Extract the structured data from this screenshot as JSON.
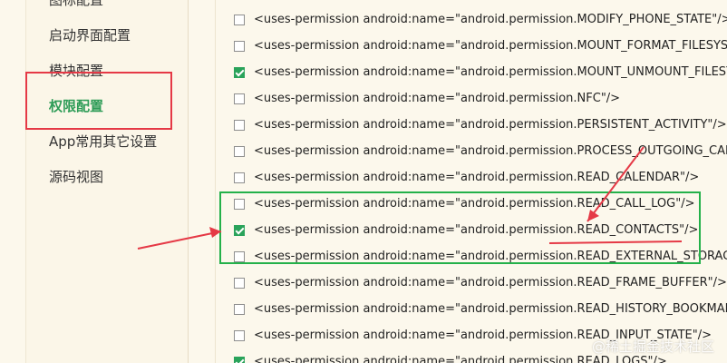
{
  "sidebar": {
    "items": [
      {
        "label": "图标配置"
      },
      {
        "label": "启动界面配置"
      },
      {
        "label": "模块配置"
      },
      {
        "label": "权限配置",
        "active": true
      },
      {
        "label": "App常用其它设置"
      },
      {
        "label": "源码视图"
      }
    ]
  },
  "permissions": [
    {
      "text": "<uses-permission android:name=\"android.permission.MODIFY_PHONE_STATE\"/>",
      "checked": false
    },
    {
      "text": "<uses-permission android:name=\"android.permission.MOUNT_FORMAT_FILESYSTEMS\"/>",
      "checked": false
    },
    {
      "text": "<uses-permission android:name=\"android.permission.MOUNT_UNMOUNT_FILESYSTEMS\"/>",
      "checked": true
    },
    {
      "text": "<uses-permission android:name=\"android.permission.NFC\"/>",
      "checked": false
    },
    {
      "text": "<uses-permission android:name=\"android.permission.PERSISTENT_ACTIVITY\"/>",
      "checked": false
    },
    {
      "text": "<uses-permission android:name=\"android.permission.PROCESS_OUTGOING_CALLS\"/>",
      "checked": false
    },
    {
      "text": "<uses-permission android:name=\"android.permission.READ_CALENDAR\"/>",
      "checked": false
    },
    {
      "text": "<uses-permission android:name=\"android.permission.READ_CALL_LOG\"/>",
      "checked": false
    },
    {
      "text": "<uses-permission android:name=\"android.permission.READ_CONTACTS\"/>",
      "checked": true
    },
    {
      "text": "<uses-permission android:name=\"android.permission.READ_EXTERNAL_STORAGE\"/>",
      "checked": false
    },
    {
      "text": "<uses-permission android:name=\"android.permission.READ_FRAME_BUFFER\"/>",
      "checked": false
    },
    {
      "text": "<uses-permission android:name=\"android.permission.READ_HISTORY_BOOKMARKS\"/>",
      "checked": false
    },
    {
      "text": "<uses-permission android:name=\"android.permission.READ_INPUT_STATE\"/>",
      "checked": false
    },
    {
      "text": "<uses-permission android:name=\"android.permission.READ_LOGS\"/>",
      "checked": true
    }
  ],
  "watermark": "@稀土掘金技术社区",
  "colors": {
    "accent": "#2e9c57",
    "annotation_red": "#e53946",
    "annotation_green": "#24b14a",
    "background": "#fcf8ec"
  }
}
